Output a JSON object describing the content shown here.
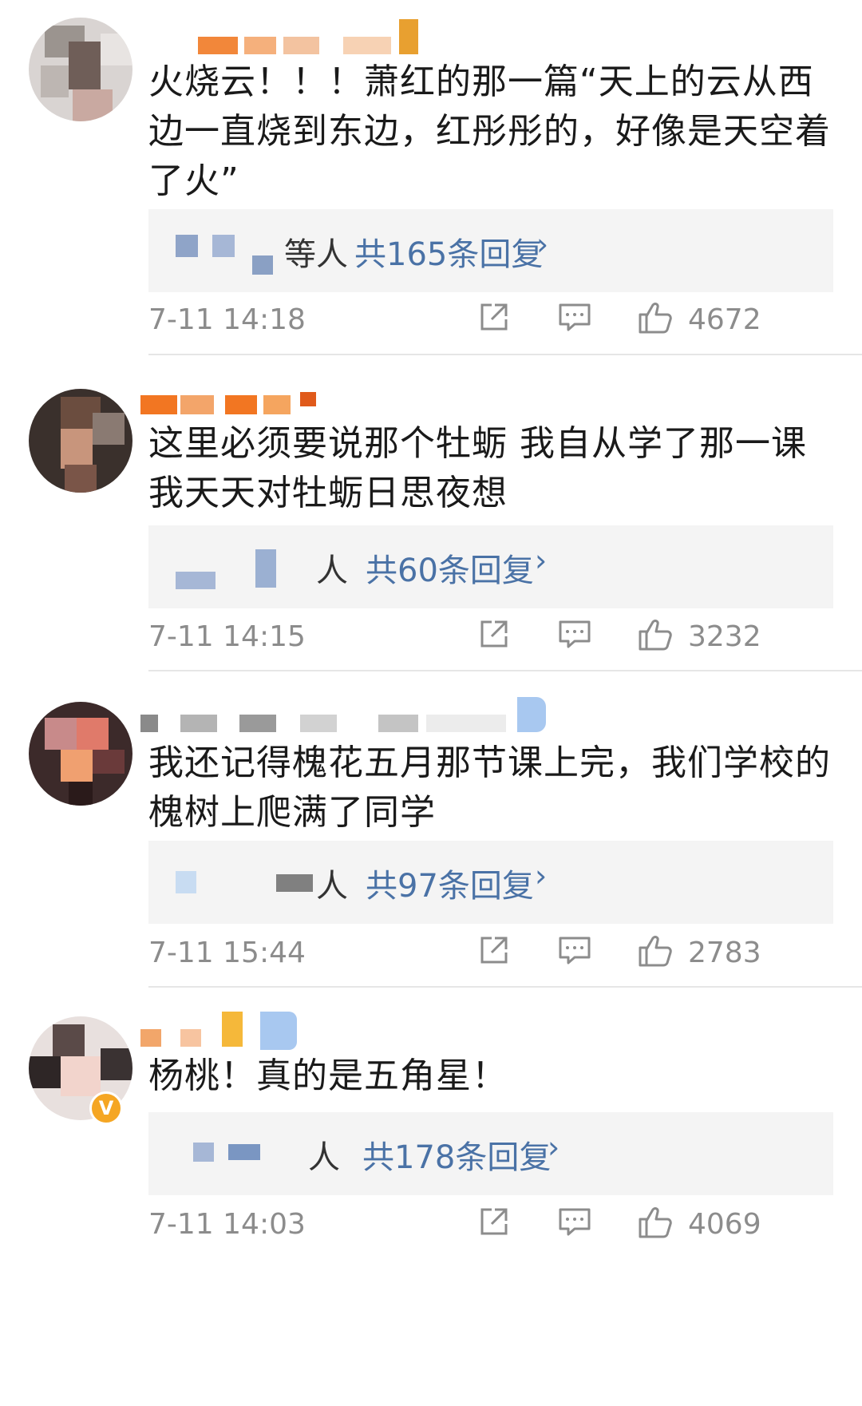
{
  "comments": [
    {
      "text": "火烧云！！！萧红的那一篇“天上的云从西边一直烧到东边，红彤彤的，好像是天空着了火”",
      "reply_people_suffix": "等人",
      "reply_count": "共165条回复",
      "time": "7-11 14:18",
      "likes": "4672"
    },
    {
      "text": "这里必须要说那个牡蛎 我自从学了那一课我天天对牡蛎日思夜想",
      "reply_people_suffix": "人",
      "reply_count": "共60条回复",
      "time": "7-11 14:15",
      "likes": "3232"
    },
    {
      "text": "我还记得槐花五月那节课上完，我们学校的槐树上爬满了同学",
      "reply_people_suffix": "人",
      "reply_count": "共97条回复",
      "time": "7-11 15:44",
      "likes": "2783"
    },
    {
      "text": "杨桃！真的是五角星！",
      "reply_people_suffix": "人",
      "reply_count": "共178条回复",
      "time": "7-11 14:03",
      "likes": "4069"
    }
  ],
  "icons": {
    "share": "share-icon",
    "comment": "comment-icon",
    "like": "thumbs-up-icon",
    "chevron": "chevron-right-icon"
  },
  "colors": {
    "link_blue": "#4a72a6",
    "meta_gray": "#8c8c8c",
    "reply_bg": "#f4f4f4"
  }
}
